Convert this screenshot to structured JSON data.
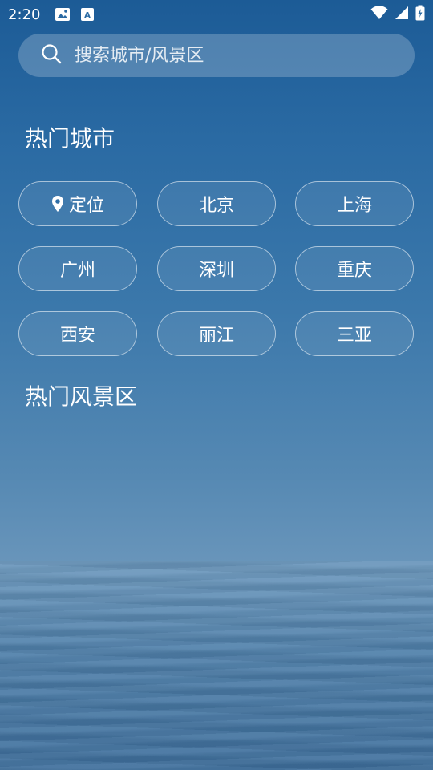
{
  "status_bar": {
    "time": "2:20",
    "left_icons": [
      "image-icon",
      "font-download-icon"
    ],
    "right_icons": [
      "wifi-icon",
      "signal-icon",
      "battery-icon"
    ]
  },
  "search": {
    "placeholder": "搜索城市/风景区",
    "icon": "search-icon"
  },
  "hot_cities": {
    "title": "热门城市",
    "items": [
      {
        "label": "定位",
        "icon": "location-pin-icon"
      },
      {
        "label": "北京"
      },
      {
        "label": "上海"
      },
      {
        "label": "广州"
      },
      {
        "label": "深圳"
      },
      {
        "label": "重庆"
      },
      {
        "label": "西安"
      },
      {
        "label": "丽江"
      },
      {
        "label": "三亚"
      }
    ]
  },
  "hot_scenic": {
    "title": "热门风景区"
  }
}
